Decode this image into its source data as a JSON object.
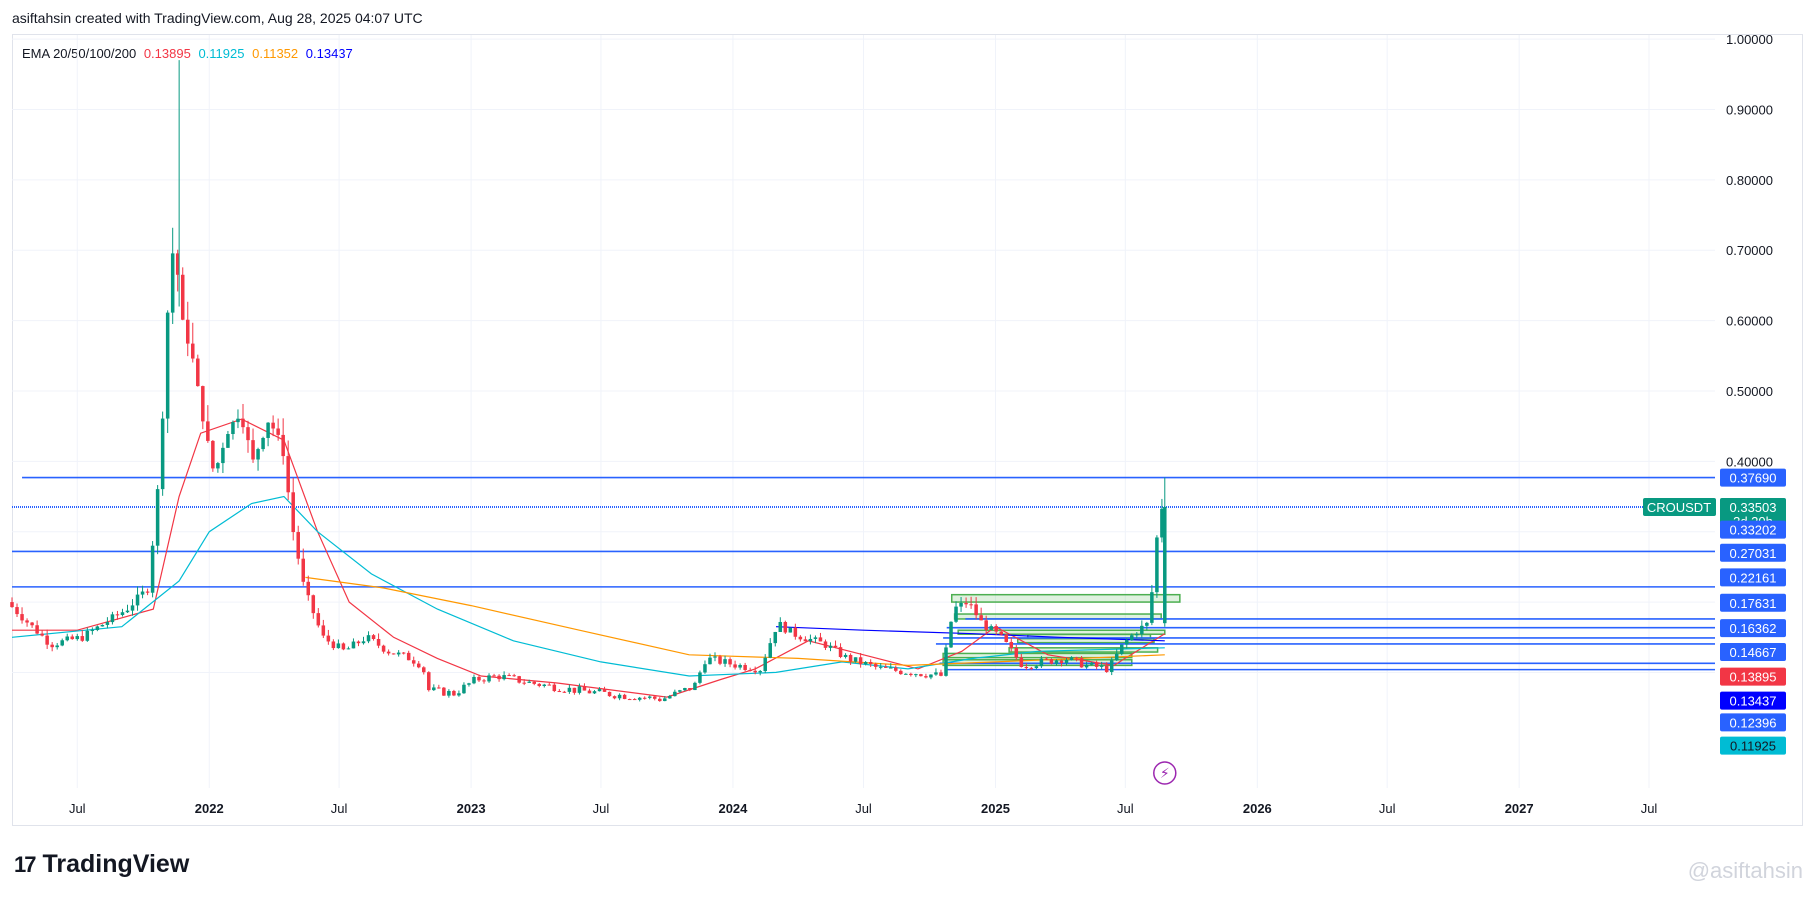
{
  "header": {
    "text": "asiftahsin created with TradingView.com, Aug 28, 2025 04:07 UTC"
  },
  "legend": {
    "label": "EMA 20/50/100/200",
    "values": [
      {
        "text": "0.13895",
        "color": "#f23645"
      },
      {
        "text": "0.11925",
        "color": "#00bcd4"
      },
      {
        "text": "0.11352",
        "color": "#ff9800"
      },
      {
        "text": "0.13437",
        "color": "#0000ff"
      }
    ]
  },
  "footer": {
    "brand": "TradingView",
    "watermark": "@asiftahsin"
  },
  "colors": {
    "up": "#089981",
    "down": "#f23645",
    "hline": "#2962ff",
    "grid": "#f0f3fa",
    "zone": "#4caf50"
  },
  "chart_data": {
    "type": "candlestick",
    "symbol": "CROUSDT",
    "countdown": "3d 20h",
    "last_price": 0.33503,
    "y_axis": {
      "min": -0.05,
      "max": 1.02,
      "ticks": [
        0.4,
        0.5,
        0.6,
        0.7,
        0.8,
        0.9,
        1.0
      ],
      "tick_labels": [
        "0.40000",
        "0.50000",
        "0.60000",
        "0.70000",
        "0.80000",
        "0.90000",
        "1.00000"
      ]
    },
    "x_axis": {
      "range": [
        "2021-04-01",
        "2027-10-01"
      ],
      "ticks": [
        {
          "date": "2021-07-01",
          "label": "Jul",
          "bold": false
        },
        {
          "date": "2022-01-01",
          "label": "2022",
          "bold": true
        },
        {
          "date": "2022-07-01",
          "label": "Jul",
          "bold": false
        },
        {
          "date": "2023-01-01",
          "label": "2023",
          "bold": true
        },
        {
          "date": "2023-07-01",
          "label": "Jul",
          "bold": false
        },
        {
          "date": "2024-01-01",
          "label": "2024",
          "bold": true
        },
        {
          "date": "2024-07-01",
          "label": "Jul",
          "bold": false
        },
        {
          "date": "2025-01-01",
          "label": "2025",
          "bold": true
        },
        {
          "date": "2025-07-01",
          "label": "Jul",
          "bold": false
        },
        {
          "date": "2026-01-01",
          "label": "2026",
          "bold": true
        },
        {
          "date": "2026-07-01",
          "label": "Jul",
          "bold": false
        },
        {
          "date": "2027-01-01",
          "label": "2027",
          "bold": true
        },
        {
          "date": "2027-07-01",
          "label": "Jul",
          "bold": false
        }
      ]
    },
    "horizontal_lines": [
      {
        "price": 0.3769,
        "start": "2021-04-15"
      },
      {
        "price": 0.335,
        "start": "2021-04-01",
        "dotted": true
      },
      {
        "price": 0.272,
        "start": "2021-04-01"
      },
      {
        "price": 0.2216,
        "start": "2021-04-01"
      },
      {
        "price": 0.176,
        "start": "2024-11-20"
      },
      {
        "price": 0.1636,
        "start": "2024-10-25"
      },
      {
        "price": 0.149,
        "start": "2024-10-20"
      },
      {
        "price": 0.1405,
        "start": "2024-10-10"
      },
      {
        "price": 0.113,
        "start": "2024-10-15"
      },
      {
        "price": 0.104,
        "start": "2024-10-25"
      }
    ],
    "price_labels": [
      {
        "price": 0.3769,
        "text": "0.37690",
        "bg": "#2962ff",
        "fg": "#ffffff"
      },
      {
        "price": 0.33503,
        "text": "0.33503",
        "bg": "#089981",
        "fg": "#ffffff",
        "sub": "3d 20h"
      },
      {
        "price": 0.303,
        "text": "0.33202",
        "bg": "#2962ff",
        "fg": "#ffffff"
      },
      {
        "price": 0.27,
        "text": "0.27031",
        "bg": "#2962ff",
        "fg": "#ffffff"
      },
      {
        "price": 0.235,
        "text": "0.22161",
        "bg": "#2962ff",
        "fg": "#ffffff"
      },
      {
        "price": 0.199,
        "text": "0.17631",
        "bg": "#2962ff",
        "fg": "#ffffff"
      },
      {
        "price": 0.163,
        "text": "0.16362",
        "bg": "#2962ff",
        "fg": "#ffffff"
      },
      {
        "price": 0.129,
        "text": "0.14667",
        "bg": "#2962ff",
        "fg": "#ffffff"
      },
      {
        "price": 0.094,
        "text": "0.13895",
        "bg": "#f23645",
        "fg": "#ffffff"
      },
      {
        "price": 0.06,
        "text": "0.13437",
        "bg": "#0000ff",
        "fg": "#ffffff"
      },
      {
        "price": 0.029,
        "text": "0.12396",
        "bg": "#2962ff",
        "fg": "#ffffff"
      },
      {
        "price": -0.004,
        "text": "0.11925",
        "bg": "#00bcd4",
        "fg": "#131722"
      }
    ],
    "zones": [
      {
        "x1": "2024-11-01",
        "x2": "2025-09-15",
        "y1": 0.2105,
        "y2": 0.2
      },
      {
        "x1": "2024-11-05",
        "x2": "2025-08-20",
        "y1": 0.183,
        "y2": 0.176
      },
      {
        "x1": "2024-11-10",
        "x2": "2025-08-25",
        "y1": 0.16,
        "y2": 0.155
      },
      {
        "x1": "2024-10-20",
        "x2": "2025-07-10",
        "y1": 0.127,
        "y2": 0.121
      },
      {
        "x1": "2024-10-20",
        "x2": "2025-07-10",
        "y1": 0.118,
        "y2": 0.11
      },
      {
        "x1": "2025-01-20",
        "x2": "2025-08-15",
        "y1": 0.135,
        "y2": 0.129
      },
      {
        "x1": "2025-02-01",
        "x2": "2025-08-10",
        "y1": 0.148,
        "y2": 0.143
      },
      {
        "x1": "2025-02-15",
        "x2": "2025-08-05",
        "y1": 0.154,
        "y2": 0.15
      }
    ],
    "price_path": [
      {
        "t": "2021-04-01",
        "p": 0.2
      },
      {
        "t": "2021-05-01",
        "p": 0.17
      },
      {
        "t": "2021-06-01",
        "p": 0.14
      },
      {
        "t": "2021-07-15",
        "p": 0.15
      },
      {
        "t": "2021-08-15",
        "p": 0.17
      },
      {
        "t": "2021-09-15",
        "p": 0.19
      },
      {
        "t": "2021-10-15",
        "p": 0.22
      },
      {
        "t": "2021-11-01",
        "p": 0.4
      },
      {
        "t": "2021-11-10",
        "p": 0.6
      },
      {
        "t": "2021-11-20",
        "p": 0.72
      },
      {
        "t": "2021-12-01",
        "p": 0.6
      },
      {
        "t": "2021-12-15",
        "p": 0.55
      },
      {
        "t": "2022-01-01",
        "p": 0.45
      },
      {
        "t": "2022-01-15",
        "p": 0.38
      },
      {
        "t": "2022-02-01",
        "p": 0.44
      },
      {
        "t": "2022-02-20",
        "p": 0.47
      },
      {
        "t": "2022-03-10",
        "p": 0.4
      },
      {
        "t": "2022-04-01",
        "p": 0.46
      },
      {
        "t": "2022-04-20",
        "p": 0.42
      },
      {
        "t": "2022-05-05",
        "p": 0.3
      },
      {
        "t": "2022-05-20",
        "p": 0.22
      },
      {
        "t": "2022-06-15",
        "p": 0.15
      },
      {
        "t": "2022-07-15",
        "p": 0.13
      },
      {
        "t": "2022-08-15",
        "p": 0.15
      },
      {
        "t": "2022-09-15",
        "p": 0.13
      },
      {
        "t": "2022-10-15",
        "p": 0.12
      },
      {
        "t": "2022-11-01",
        "p": 0.11
      },
      {
        "t": "2022-11-10",
        "p": 0.075
      },
      {
        "t": "2022-12-15",
        "p": 0.07
      },
      {
        "t": "2023-01-15",
        "p": 0.09
      },
      {
        "t": "2023-02-15",
        "p": 0.095
      },
      {
        "t": "2023-04-01",
        "p": 0.085
      },
      {
        "t": "2023-06-01",
        "p": 0.075
      },
      {
        "t": "2023-08-01",
        "p": 0.068
      },
      {
        "t": "2023-10-01",
        "p": 0.062
      },
      {
        "t": "2023-11-15",
        "p": 0.08
      },
      {
        "t": "2023-12-01",
        "p": 0.12
      },
      {
        "t": "2024-01-15",
        "p": 0.11
      },
      {
        "t": "2024-02-15",
        "p": 0.105
      },
      {
        "t": "2024-03-10",
        "p": 0.17
      },
      {
        "t": "2024-04-01",
        "p": 0.155
      },
      {
        "t": "2024-05-15",
        "p": 0.14
      },
      {
        "t": "2024-06-15",
        "p": 0.12
      },
      {
        "t": "2024-08-01",
        "p": 0.105
      },
      {
        "t": "2024-09-15",
        "p": 0.1
      },
      {
        "t": "2024-10-25",
        "p": 0.095
      },
      {
        "t": "2024-11-10",
        "p": 0.19
      },
      {
        "t": "2024-12-01",
        "p": 0.2
      },
      {
        "t": "2024-12-20",
        "p": 0.17
      },
      {
        "t": "2025-01-15",
        "p": 0.15
      },
      {
        "t": "2025-02-15",
        "p": 0.11
      },
      {
        "t": "2025-03-15",
        "p": 0.115
      },
      {
        "t": "2025-04-15",
        "p": 0.12
      },
      {
        "t": "2025-05-15",
        "p": 0.11
      },
      {
        "t": "2025-06-15",
        "p": 0.105
      },
      {
        "t": "2025-07-05",
        "p": 0.14
      },
      {
        "t": "2025-07-25",
        "p": 0.16
      },
      {
        "t": "2025-08-10",
        "p": 0.17
      },
      {
        "t": "2025-08-25",
        "p": 0.335
      }
    ],
    "ema_lines": [
      {
        "name": "EMA 20",
        "color": "#f23645",
        "points": [
          {
            "t": "2021-04-01",
            "p": 0.16
          },
          {
            "t": "2021-07-01",
            "p": 0.16
          },
          {
            "t": "2021-10-15",
            "p": 0.19
          },
          {
            "t": "2021-11-20",
            "p": 0.35
          },
          {
            "t": "2021-12-20",
            "p": 0.44
          },
          {
            "t": "2022-02-15",
            "p": 0.46
          },
          {
            "t": "2022-04-15",
            "p": 0.43
          },
          {
            "t": "2022-06-01",
            "p": 0.3
          },
          {
            "t": "2022-07-15",
            "p": 0.2
          },
          {
            "t": "2022-09-15",
            "p": 0.15
          },
          {
            "t": "2022-11-15",
            "p": 0.12
          },
          {
            "t": "2023-01-15",
            "p": 0.095
          },
          {
            "t": "2023-05-01",
            "p": 0.085
          },
          {
            "t": "2023-10-01",
            "p": 0.065
          },
          {
            "t": "2023-12-15",
            "p": 0.09
          },
          {
            "t": "2024-02-01",
            "p": 0.105
          },
          {
            "t": "2024-04-15",
            "p": 0.145
          },
          {
            "t": "2024-07-01",
            "p": 0.125
          },
          {
            "t": "2024-09-15",
            "p": 0.105
          },
          {
            "t": "2024-11-15",
            "p": 0.13
          },
          {
            "t": "2025-01-01",
            "p": 0.165
          },
          {
            "t": "2025-03-15",
            "p": 0.125
          },
          {
            "t": "2025-06-15",
            "p": 0.11
          },
          {
            "t": "2025-08-25",
            "p": 0.155
          }
        ]
      },
      {
        "name": "EMA 50",
        "color": "#00bcd4",
        "points": [
          {
            "t": "2021-04-01",
            "p": 0.15
          },
          {
            "t": "2021-09-01",
            "p": 0.165
          },
          {
            "t": "2021-11-20",
            "p": 0.23
          },
          {
            "t": "2022-01-01",
            "p": 0.3
          },
          {
            "t": "2022-03-01",
            "p": 0.34
          },
          {
            "t": "2022-04-15",
            "p": 0.35
          },
          {
            "t": "2022-06-01",
            "p": 0.3
          },
          {
            "t": "2022-08-15",
            "p": 0.24
          },
          {
            "t": "2022-11-15",
            "p": 0.19
          },
          {
            "t": "2023-03-01",
            "p": 0.145
          },
          {
            "t": "2023-07-01",
            "p": 0.115
          },
          {
            "t": "2023-11-01",
            "p": 0.095
          },
          {
            "t": "2024-03-01",
            "p": 0.1
          },
          {
            "t": "2024-06-01",
            "p": 0.115
          },
          {
            "t": "2024-09-01",
            "p": 0.105
          },
          {
            "t": "2024-12-01",
            "p": 0.12
          },
          {
            "t": "2025-03-01",
            "p": 0.13
          },
          {
            "t": "2025-08-25",
            "p": 0.135
          }
        ]
      },
      {
        "name": "EMA 100",
        "color": "#ff9800",
        "points": [
          {
            "t": "2022-05-15",
            "p": 0.235
          },
          {
            "t": "2022-09-01",
            "p": 0.22
          },
          {
            "t": "2023-01-01",
            "p": 0.195
          },
          {
            "t": "2023-06-01",
            "p": 0.16
          },
          {
            "t": "2023-11-01",
            "p": 0.125
          },
          {
            "t": "2024-04-01",
            "p": 0.12
          },
          {
            "t": "2024-09-01",
            "p": 0.11
          },
          {
            "t": "2025-01-01",
            "p": 0.115
          },
          {
            "t": "2025-05-01",
            "p": 0.12
          },
          {
            "t": "2025-08-25",
            "p": 0.125
          }
        ]
      },
      {
        "name": "EMA 200",
        "color": "#0000ff",
        "points": [
          {
            "t": "2024-03-01",
            "p": 0.165
          },
          {
            "t": "2024-07-01",
            "p": 0.16
          },
          {
            "t": "2024-12-01",
            "p": 0.155
          },
          {
            "t": "2025-04-01",
            "p": 0.15
          },
          {
            "t": "2025-08-25",
            "p": 0.145
          }
        ]
      }
    ]
  }
}
